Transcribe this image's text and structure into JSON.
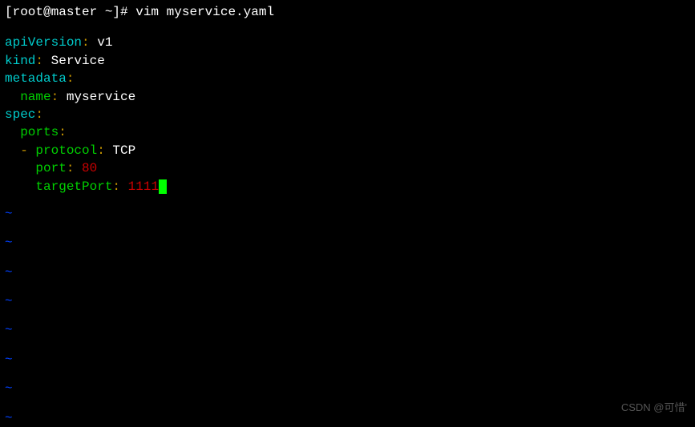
{
  "prompt": {
    "text": "[root@master ~]# vim myservice.yaml"
  },
  "yaml": {
    "lines": [
      {
        "indent": "",
        "key": "apiVersion",
        "keyClass": "key-teal",
        "value": " v1",
        "valClass": "val-white"
      },
      {
        "indent": "",
        "key": "kind",
        "keyClass": "key-teal",
        "value": " Service",
        "valClass": "val-white"
      },
      {
        "indent": "",
        "key": "metadata",
        "keyClass": "key-teal",
        "value": "",
        "valClass": ""
      },
      {
        "indent": "  ",
        "key": "name",
        "keyClass": "key-green",
        "value": " myservice",
        "valClass": "val-white"
      },
      {
        "indent": "",
        "key": "spec",
        "keyClass": "key-teal",
        "value": "",
        "valClass": ""
      },
      {
        "indent": "  ",
        "key": "ports",
        "keyClass": "key-green",
        "value": "",
        "valClass": ""
      },
      {
        "indent": "  ",
        "dash": "- ",
        "key": "protocol",
        "keyClass": "key-green",
        "value": " TCP",
        "valClass": "val-white"
      },
      {
        "indent": "    ",
        "key": "port",
        "keyClass": "key-green",
        "value": " 80",
        "valClass": "val-red"
      },
      {
        "indent": "    ",
        "key": "targetPort",
        "keyClass": "key-green",
        "value": " 1111",
        "valClass": "val-red",
        "cursor": true
      }
    ]
  },
  "tilde": "~",
  "tildeCount": 8,
  "watermark": "CSDN @可惜'"
}
